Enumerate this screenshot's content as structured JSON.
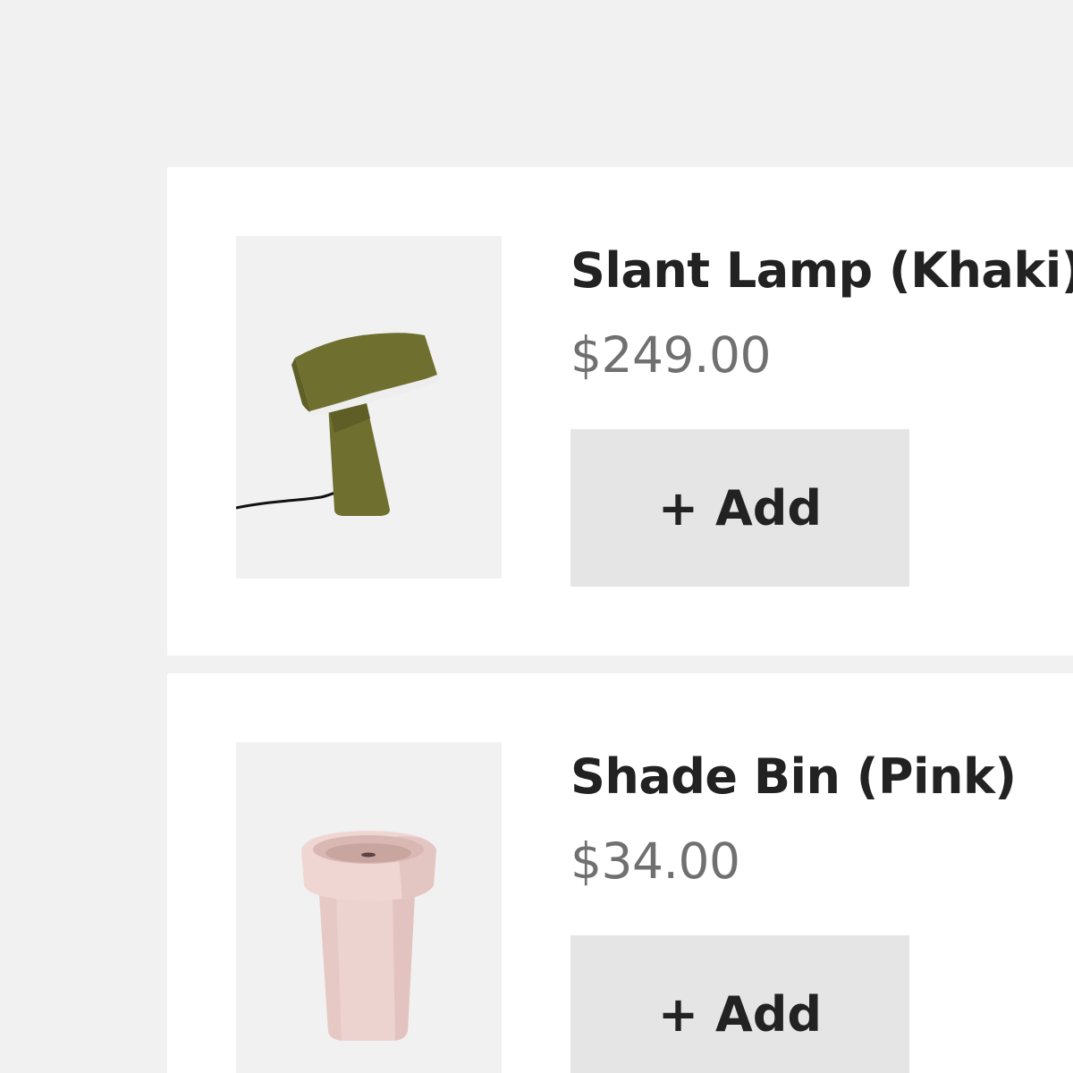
{
  "products": [
    {
      "name": "Slant Lamp (Khaki)",
      "price": "$249.00",
      "add_label": "+ Add",
      "image_icon": "desk-lamp",
      "color": "#6f6f2f"
    },
    {
      "name": "Shade Bin (Pink)",
      "price": "$34.00",
      "add_label": "+ Add",
      "image_icon": "waste-bin",
      "color": "#ecd3d0"
    }
  ],
  "colors": {
    "page_background": "#f1f1f1",
    "card_background": "#ffffff",
    "button_background": "#e5e5e5",
    "title_text": "#222222",
    "price_text": "#707070"
  }
}
